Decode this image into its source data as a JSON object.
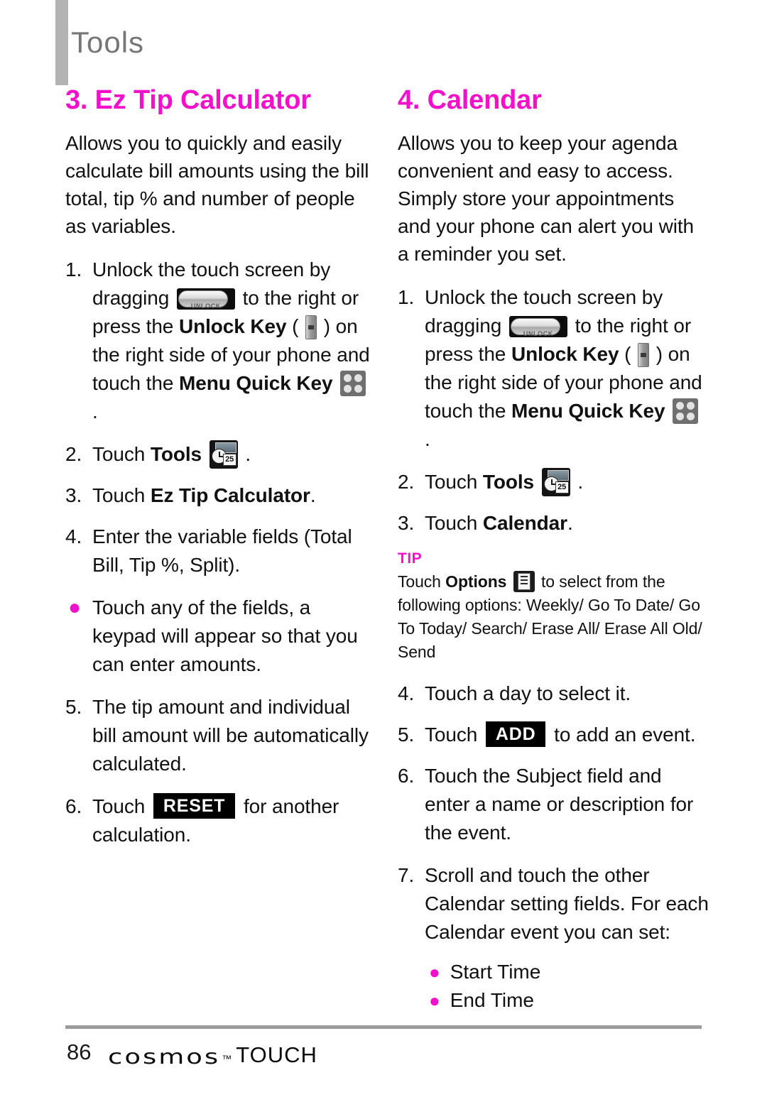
{
  "header": {
    "title": "Tools"
  },
  "left_column": {
    "section_title": "3. Ez Tip Calculator",
    "intro": "Allows you to quickly and easily calculate bill amounts using the bill total, tip % and number of people as variables.",
    "steps": [
      {
        "marker": "1.",
        "text_a": "Unlock the touch screen by dragging",
        "icon_1": "unlock-slider-icon",
        "icon_1_label": "UNLOCK",
        "text_b": "to the right or press the",
        "bold_1": "Unlock Key",
        "text_c": "(",
        "icon_2": "unlock-key-icon",
        "text_d": ") on the right side of your phone and touch the",
        "bold_2": "Menu Quick Key",
        "icon_3": "menu-quick-key-icon",
        "text_e": "."
      },
      {
        "marker": "2.",
        "text_a": "Touch",
        "bold_1": "Tools",
        "icon_1": "tools-icon",
        "icon_1_label": "25",
        "text_b": "."
      },
      {
        "marker": "3.",
        "text_a": "Touch",
        "bold_1": "Ez Tip Calculator",
        "text_b": "."
      },
      {
        "marker": "4.",
        "text_a": "Enter the variable fields (Total Bill, Tip %, Split)."
      },
      {
        "marker": "●",
        "type": "bullet",
        "text_a": "Touch any of the fields, a keypad will appear so that you can enter amounts."
      },
      {
        "marker": "5.",
        "text_a": "The tip amount and individual bill amount will be automatically calculated."
      },
      {
        "marker": "6.",
        "text_a": "Touch",
        "keycap": "RESET",
        "text_b": "for another calculation."
      }
    ]
  },
  "right_column": {
    "section_title": "4. Calendar",
    "intro": "Allows you to keep your agenda convenient and easy to access. Simply store your appointments and your phone can alert you with a reminder you set.",
    "steps": [
      {
        "marker": "1.",
        "text_a": "Unlock the touch screen by dragging",
        "icon_1": "unlock-slider-icon",
        "icon_1_label": "UNLOCK",
        "text_b": "to the right or press the",
        "bold_1": "Unlock Key",
        "text_c": "(",
        "icon_2": "unlock-key-icon",
        "text_d": ") on the right side of your phone and touch the",
        "bold_2": "Menu Quick Key",
        "icon_3": "menu-quick-key-icon",
        "text_e": "."
      },
      {
        "marker": "2.",
        "text_a": "Touch",
        "bold_1": "Tools",
        "icon_1": "tools-icon",
        "icon_1_label": "25",
        "text_b": "."
      },
      {
        "marker": "3.",
        "text_a": "Touch",
        "bold_1": "Calendar",
        "text_b": "."
      }
    ],
    "tip": {
      "label": "TIP",
      "text_a": "Touch",
      "bold_1": "Options",
      "icon_1": "options-icon",
      "text_b": "to select from the following options: Weekly/ Go To Date/ Go To Today/ Search/ Erase All/ Erase All Old/ Send"
    },
    "steps_after_tip": [
      {
        "marker": "4.",
        "text_a": "Touch a day to select it."
      },
      {
        "marker": "5.",
        "text_a": "Touch",
        "keycap": "ADD",
        "text_b": "to add an event."
      },
      {
        "marker": "6.",
        "text_a": "Touch the Subject field and enter a name or description for the event."
      },
      {
        "marker": "7.",
        "text_a": "Scroll and touch the other Calendar setting fields. For each Calendar event you can set:"
      }
    ],
    "inline_bullets": [
      {
        "dot": "●",
        "label": "Start Time"
      },
      {
        "dot": "●",
        "label": "End Time"
      }
    ]
  },
  "footer": {
    "page_number": "86",
    "brand_cosmos": "cosmos",
    "brand_tm": "™",
    "brand_touch": "TOUCH"
  },
  "colors": {
    "accent_magenta": "#f210c8",
    "header_gray": "#767676",
    "rule_gray": "#9b9b9b"
  }
}
